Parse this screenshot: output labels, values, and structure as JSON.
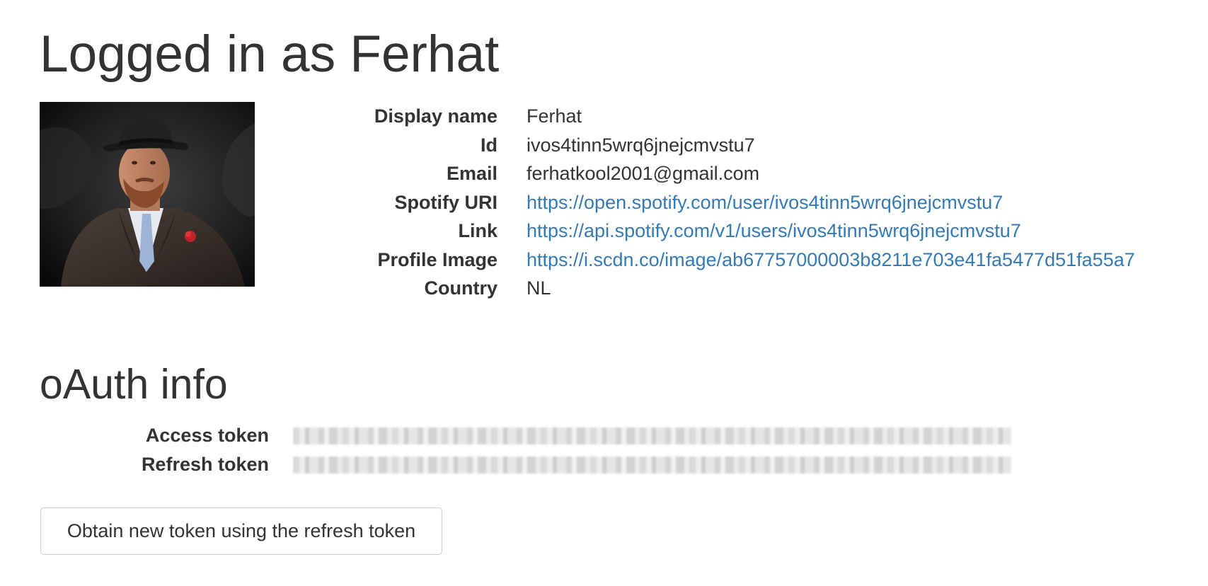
{
  "page_title": "Logged in as Ferhat",
  "profile": {
    "avatar_alt": "profile photo",
    "fields": [
      {
        "label": "Display name",
        "value": "Ferhat"
      },
      {
        "label": "Id",
        "value": "ivos4tinn5wrq6jnejcmvstu7"
      },
      {
        "label": "Email",
        "value": "ferhatkool2001@gmail.com"
      },
      {
        "label": "Spotify URI",
        "value": "https://open.spotify.com/user/ivos4tinn5wrq6jnejcmvstu7"
      },
      {
        "label": "Link",
        "value": "https://api.spotify.com/v1/users/ivos4tinn5wrq6jnejcmvstu7"
      },
      {
        "label": "Profile Image",
        "value": "https://i.scdn.co/image/ab67757000003b8211e703e41fa5477d51fa55a7"
      },
      {
        "label": "Country",
        "value": "NL"
      }
    ]
  },
  "oauth": {
    "title": "oAuth info",
    "fields": [
      {
        "label": "Access token"
      },
      {
        "label": "Refresh token"
      }
    ]
  },
  "refresh_button_label": "Obtain new token using the refresh token",
  "colors": {
    "text": "#333333",
    "link": "#337ab7",
    "button_border": "#cccccc"
  }
}
